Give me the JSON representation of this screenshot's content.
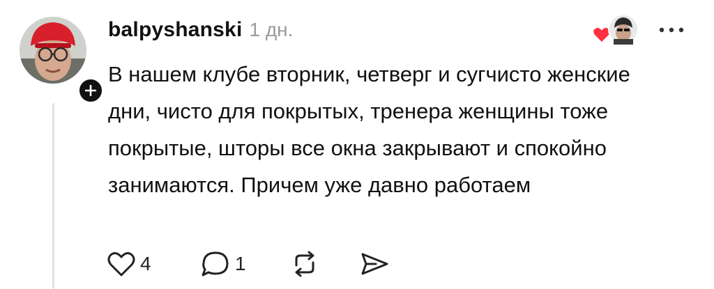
{
  "comment": {
    "username": "balpyshanski",
    "time": "1 дн.",
    "text": "В нашем клубе вторник, четверг и сугчисто женские дни, чисто для покрытых, тренера женщины тоже покрытые, шторы все окна закрывают и спокойно занимаются. Причем уже давно работаем"
  },
  "actions": {
    "likes_count": "4",
    "replies_count": "1"
  },
  "icons": {
    "avatar": "user-avatar",
    "follow": "plus-icon",
    "liked_by": "heart-icon",
    "more": "more-icon",
    "like": "heart-outline-icon",
    "reply": "comment-icon",
    "repost": "repost-icon",
    "share": "send-icon"
  },
  "colors": {
    "accent_heart": "#ff3040",
    "time_gray": "#9a9a9a"
  }
}
